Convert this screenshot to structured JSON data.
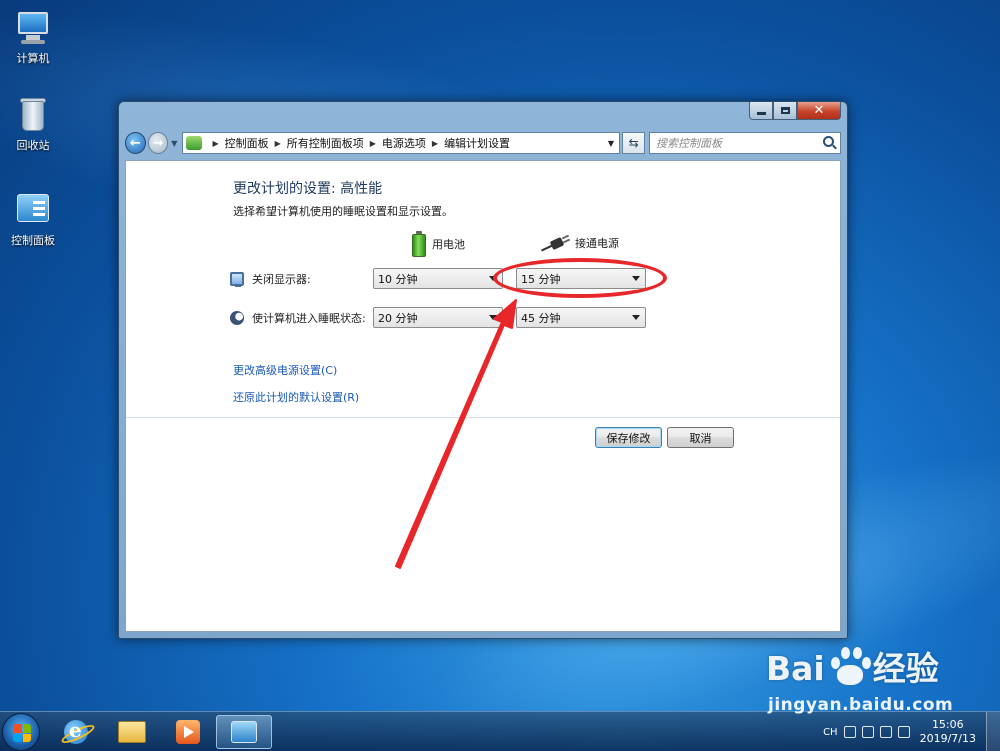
{
  "desktop": {
    "icons": [
      {
        "label": "计算机"
      },
      {
        "label": "回收站"
      },
      {
        "label": "控制面板"
      }
    ]
  },
  "window": {
    "breadcrumb": [
      "控制面板",
      "所有控制面板项",
      "电源选项",
      "编辑计划设置"
    ],
    "search_placeholder": "搜索控制面板",
    "heading": "更改计划的设置: 高性能",
    "subheading": "选择希望计算机使用的睡眠设置和显示设置。",
    "columns": {
      "battery": "用电池",
      "plugged": "接通电源"
    },
    "settings": [
      {
        "label": "关闭显示器:",
        "battery_value": "10 分钟",
        "plugged_value": "15 分钟"
      },
      {
        "label": "使计算机进入睡眠状态:",
        "battery_value": "20 分钟",
        "plugged_value": "45 分钟"
      }
    ],
    "links": {
      "advanced": "更改高级电源设置(C)",
      "restore": "还原此计划的默认设置(R)"
    },
    "buttons": {
      "save": "保存修改",
      "cancel": "取消"
    }
  },
  "taskbar": {
    "language": "CH",
    "time": "15:06",
    "date": "2019/7/13"
  },
  "watermark": {
    "brand_left": "Bai",
    "brand_right": "经验",
    "url": "jingyan.baidu.com"
  },
  "annotation_color": "#e8272b"
}
